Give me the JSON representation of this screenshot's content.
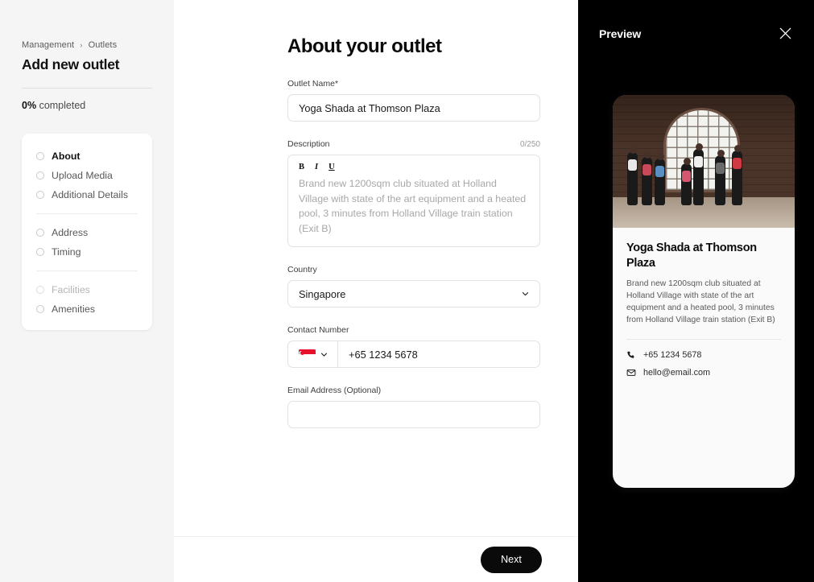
{
  "sidebar": {
    "breadcrumb": {
      "parent": "Management",
      "separator": "›",
      "current": "Outlets"
    },
    "page_title": "Add new outlet",
    "progress": {
      "percent": "0%",
      "label": "completed"
    },
    "groups": [
      {
        "items": [
          {
            "label": "About",
            "state": "active"
          },
          {
            "label": "Upload Media",
            "state": "default"
          },
          {
            "label": "Additional Details",
            "state": "default"
          }
        ]
      },
      {
        "items": [
          {
            "label": "Address",
            "state": "default"
          },
          {
            "label": "Timing",
            "state": "default"
          }
        ]
      },
      {
        "items": [
          {
            "label": "Facilities",
            "state": "muted"
          },
          {
            "label": "Amenities",
            "state": "default"
          }
        ]
      }
    ]
  },
  "form": {
    "title": "About your outlet",
    "outlet_name": {
      "label": "Outlet Name*",
      "value": "Yoga Shada at Thomson Plaza"
    },
    "description": {
      "label": "Description",
      "counter": "0/250",
      "toolbar": {
        "bold": "B",
        "italic": "I",
        "underline": "U"
      },
      "placeholder": "Brand new 1200sqm club situated at Holland Village with state of the art equipment and a heated pool, 3 minutes from Holland Village train station (Exit B)"
    },
    "country": {
      "label": "Country",
      "value": "Singapore"
    },
    "contact_number": {
      "label": "Contact Number",
      "flag": "singapore-flag",
      "value": "+65  1234 5678"
    },
    "email": {
      "label": "Email Address (Optional)",
      "value": ""
    },
    "next_button": "Next"
  },
  "preview": {
    "title": "Preview",
    "close_icon": "close-icon",
    "card": {
      "image_alt": "fitness-class-photo",
      "title": "Yoga Shada at Thomson Plaza",
      "description": "Brand new 1200sqm club situated at Holland Village with state of the art equipment and a heated pool, 3 minutes from Holland Village train station (Exit B)",
      "contacts": [
        {
          "icon": "phone-icon",
          "text": "+65 1234 5678"
        },
        {
          "icon": "envelope-icon",
          "text": "hello@email.com"
        }
      ]
    }
  },
  "colors": {
    "panel_bg": "#f5f5f5",
    "preview_bg": "#000000",
    "accent": "#0a0a0a",
    "flag_red": "#e8112d"
  }
}
